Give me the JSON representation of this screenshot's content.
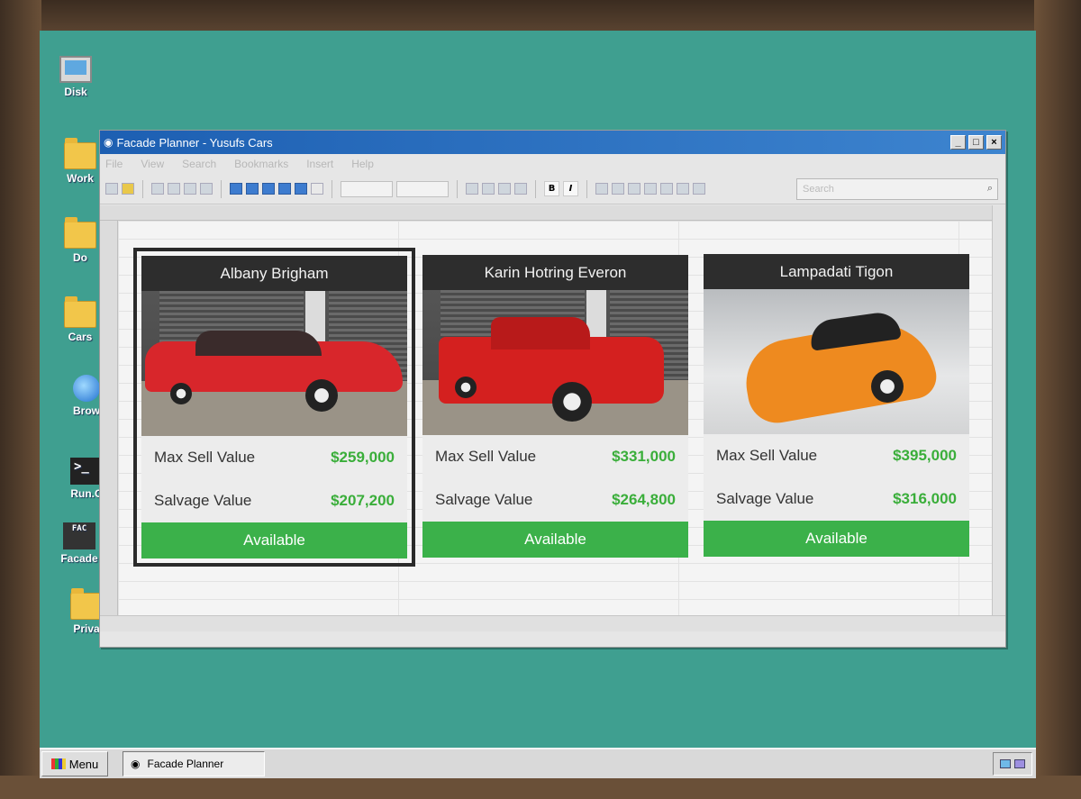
{
  "desktop": {
    "icons": [
      {
        "label": "Disk"
      },
      {
        "label": "Work"
      },
      {
        "label": "Do"
      },
      {
        "label": "Cars"
      },
      {
        "label": "Brow"
      },
      {
        "label": "Run.C"
      },
      {
        "label": "Facade"
      },
      {
        "label": "Priva"
      }
    ],
    "facade_icon_text": "FAC"
  },
  "window": {
    "title": "Facade Planner - Yusufs Cars",
    "controls": {
      "minimize": "_",
      "maximize": "□",
      "close": "×"
    },
    "menu": [
      "File",
      "View",
      "Search",
      "Bookmarks",
      "Insert",
      "Help"
    ],
    "search_placeholder": "Search",
    "bold_label": "B",
    "italic_label": "I"
  },
  "cars": [
    {
      "name": "Albany Brigham",
      "max_sell_label": "Max Sell Value",
      "max_sell_value": "$259,000",
      "salvage_label": "Salvage Value",
      "salvage_value": "$207,200",
      "status": "Available",
      "selected": true,
      "body_color": "#d8262b"
    },
    {
      "name": "Karin Hotring Everon",
      "max_sell_label": "Max Sell Value",
      "max_sell_value": "$331,000",
      "salvage_label": "Salvage Value",
      "salvage_value": "$264,800",
      "status": "Available",
      "selected": false,
      "body_color": "#d4201f"
    },
    {
      "name": "Lampadati Tigon",
      "max_sell_label": "Max Sell Value",
      "max_sell_value": "$395,000",
      "salvage_label": "Salvage Value",
      "salvage_value": "$316,000",
      "status": "Available",
      "selected": false,
      "body_color": "#ee8a1f"
    }
  ],
  "colors": {
    "accent_green": "#3bb14a",
    "value_green": "#3aae3a",
    "titlebar_blue": "#1d5fb2",
    "desktop_teal": "#3f9f90"
  },
  "taskbar": {
    "start_label": "Menu",
    "tasks": [
      {
        "label": "Facade Planner"
      }
    ]
  }
}
